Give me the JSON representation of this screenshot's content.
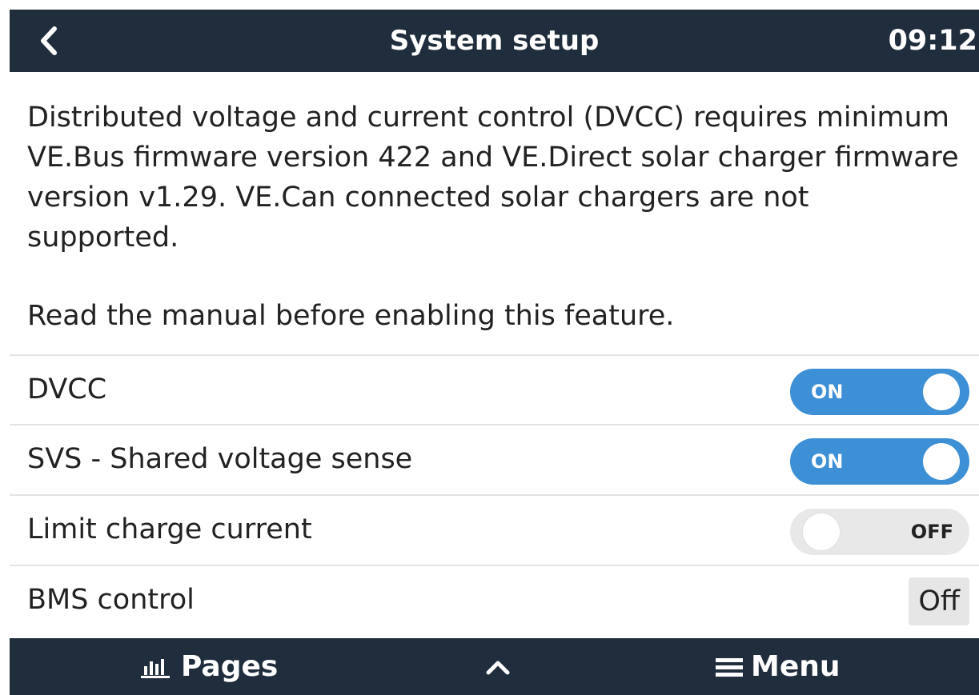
{
  "header": {
    "title": "System setup",
    "time": "09:12"
  },
  "info": {
    "paragraph1": "Distributed voltage and current control (DVCC) requires minimum VE.Bus firmware version 422 and VE.Direct solar charger firmware version v1.29. VE.Can connected solar chargers are not supported.",
    "paragraph2": "Read the manual before enabling this feature."
  },
  "settings": [
    {
      "label": "DVCC",
      "control": "toggle",
      "state": "ON"
    },
    {
      "label": "SVS - Shared voltage sense",
      "control": "toggle",
      "state": "ON"
    },
    {
      "label": "Limit charge current",
      "control": "toggle",
      "state": "OFF"
    },
    {
      "label": "BMS control",
      "control": "value",
      "value": "Off"
    }
  ],
  "footer": {
    "pages_label": "Pages",
    "menu_label": "Menu"
  },
  "icons": {
    "back": "chevron-left-icon",
    "pages": "bar-chart-icon",
    "up": "chevron-up-icon",
    "menu": "hamburger-menu-icon"
  },
  "colors": {
    "bar_background": "#1f2d3d",
    "toggle_on": "#3d8fd6",
    "toggle_off": "#e8e8e8",
    "divider": "#e3e3e3"
  }
}
